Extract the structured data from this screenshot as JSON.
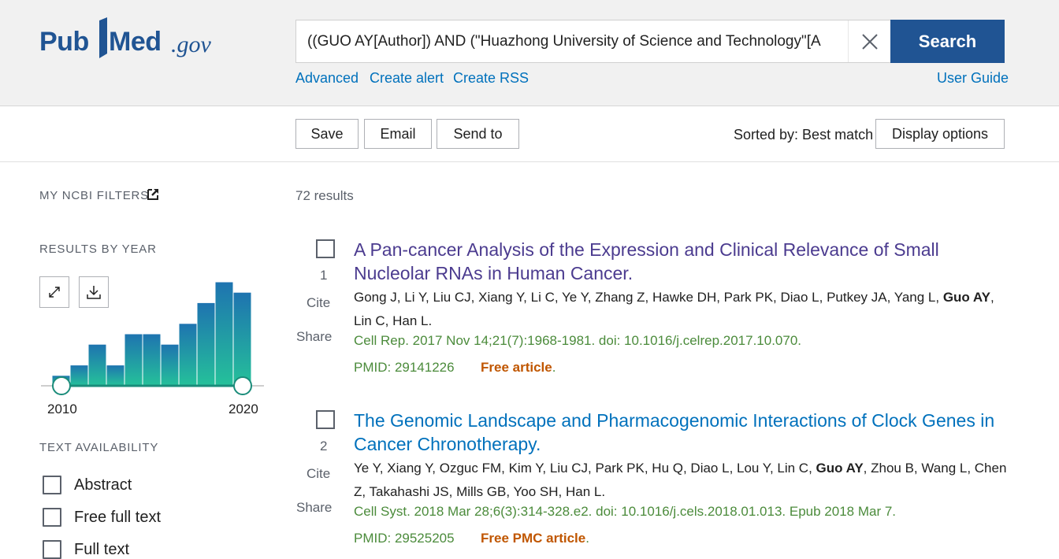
{
  "header": {
    "logo": {
      "pub": "Pub",
      "med": "Med",
      "gov": ".gov"
    },
    "search": {
      "value": "((GUO AY[Author]) AND (\"Huazhong University of Science and Technology\"[A",
      "button": "Search"
    },
    "links": {
      "advanced": "Advanced",
      "create_alert": "Create alert",
      "create_rss": "Create RSS",
      "user_guide": "User Guide"
    }
  },
  "toolbar": {
    "save": "Save",
    "email": "Email",
    "send_to": "Send to",
    "sorted_by": "Sorted by: Best match",
    "display_options": "Display options"
  },
  "sidebar": {
    "my_ncbi_filters": "MY NCBI FILTERS",
    "results_by_year": "RESULTS BY YEAR",
    "year_start": "2010",
    "year_end": "2020",
    "text_availability": "TEXT AVAILABILITY",
    "filters": [
      {
        "label": "Abstract",
        "checked": false
      },
      {
        "label": "Free full text",
        "checked": false
      },
      {
        "label": "Full text",
        "checked": false
      }
    ]
  },
  "chart_data": {
    "type": "bar",
    "categories": [
      "2010",
      "2011",
      "2012",
      "2013",
      "2014",
      "2015",
      "2016",
      "2017",
      "2018",
      "2019",
      "2020"
    ],
    "values": [
      1,
      2,
      4,
      2,
      5,
      5,
      4,
      6,
      8,
      10,
      9
    ],
    "xlabel": "",
    "ylabel": "",
    "grid": false,
    "color": "#1fa589"
  },
  "results": {
    "count_text": "72 results",
    "articles": [
      {
        "num": "1",
        "cite": "Cite",
        "share": "Share",
        "title": "A Pan-cancer Analysis of the Expression and Clinical Relevance of Small Nucleolar RNAs in Human Cancer.",
        "authors_before": "Gong J, Li Y, Liu CJ, Xiang Y, Li C, Ye Y, Zhang Z, Hawke DH, Park PK, Diao L, Putkey JA, Yang L, ",
        "authors_bold": "Guo AY",
        "authors_after": ", Lin C, Han L.",
        "citation": "Cell Rep. 2017 Nov 14;21(7):1968-1981. doi: 10.1016/j.celrep.2017.10.070.",
        "pmid": "PMID: 29141226",
        "free": "Free article",
        "free_dot": "."
      },
      {
        "num": "2",
        "cite": "Cite",
        "share": "Share",
        "title": "The Genomic Landscape and Pharmacogenomic Interactions of Clock Genes in Cancer Chronotherapy.",
        "authors_before": "Ye Y, Xiang Y, Ozguc FM, Kim Y, Liu CJ, Park PK, Hu Q, Diao L, Lou Y, Lin C, ",
        "authors_bold": "Guo AY",
        "authors_after": ", Zhou B, Wang L, Chen Z, Takahashi JS, Mills GB, Yoo SH, Han L.",
        "citation": "Cell Syst. 2018 Mar 28;6(3):314-328.e2. doi: 10.1016/j.cels.2018.01.013. Epub 2018 Mar 7.",
        "pmid": "PMID: 29525205",
        "free": "Free PMC article",
        "free_dot": "."
      }
    ]
  },
  "icons": {
    "clear": "close-icon",
    "external": "external-link-icon",
    "expand": "expand-icon",
    "download": "download-icon"
  }
}
